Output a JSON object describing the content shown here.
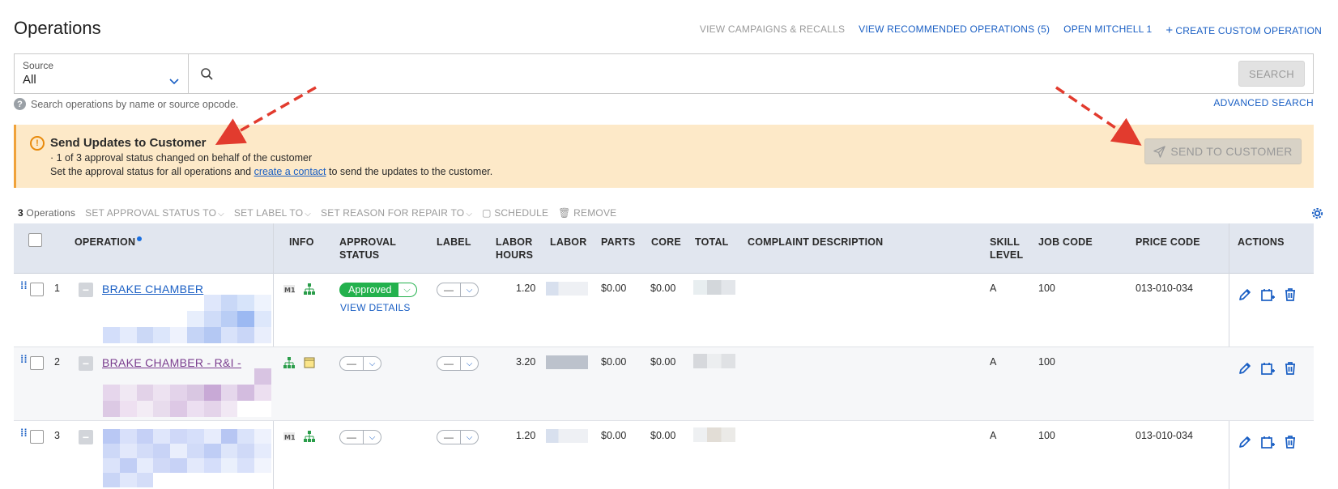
{
  "header": {
    "title": "Operations",
    "links": {
      "campaigns": "VIEW CAMPAIGNS & RECALLS",
      "recommended": "VIEW RECOMMENDED OPERATIONS (5)",
      "mitchell": "OPEN MITCHELL 1",
      "create": "CREATE CUSTOM OPERATION"
    }
  },
  "search": {
    "source_label": "Source",
    "source_value": "All",
    "placeholder": "",
    "button": "SEARCH",
    "hint": "Search operations by name or source opcode.",
    "advanced": "ADVANCED SEARCH"
  },
  "alert": {
    "title": "Send Updates to Customer",
    "line1": "· 1 of 3 approval status changed on behalf of the customer",
    "line2_pre": "Set the approval status for all operations and",
    "line2_link": "create a contact",
    "line2_post": "to send the updates to the customer.",
    "button": "SEND TO CUSTOMER",
    "colors": {
      "background": "#fde9c8",
      "accent": "#f0a23a"
    }
  },
  "toolbar": {
    "count": "3",
    "count_label": "Operations",
    "approval": "SET APPROVAL STATUS TO",
    "label": "SET LABEL TO",
    "reason": "SET REASON FOR REPAIR TO",
    "schedule": "SCHEDULE",
    "remove": "REMOVE"
  },
  "columns": {
    "operation": "OPERATION",
    "info": "INFO",
    "approval_1": "APPROVAL",
    "approval_2": "STATUS",
    "label": "LABEL",
    "labor_hours_1": "LABOR",
    "labor_hours_2": "HOURS",
    "labor": "LABOR",
    "parts": "PARTS",
    "core": "CORE",
    "total": "TOTAL",
    "complaint": "COMPLAINT DESCRIPTION",
    "skill_1": "SKILL",
    "skill_2": "LEVEL",
    "job_code": "JOB CODE",
    "price_code": "PRICE CODE",
    "actions": "ACTIONS"
  },
  "rows": [
    {
      "num": "1",
      "operation": "BRAKE CHAMBER",
      "approval": "Approved",
      "view_details": "VIEW DETAILS",
      "label": "—",
      "labor_hours": "1.20",
      "parts": "$0.00",
      "core": "$0.00",
      "skill": "A",
      "job_code": "100",
      "price_code": "013-010-034"
    },
    {
      "num": "2",
      "operation": "BRAKE CHAMBER - R&I -",
      "approval": "—",
      "label": "—",
      "labor_hours": "3.20",
      "parts": "$0.00",
      "core": "$0.00",
      "skill": "A",
      "job_code": "100",
      "price_code": ""
    },
    {
      "num": "3",
      "operation": "",
      "approval": "—",
      "label": "—",
      "labor_hours": "1.20",
      "parts": "$0.00",
      "core": "$0.00",
      "skill": "A",
      "job_code": "100",
      "price_code": "013-010-034"
    }
  ],
  "colors": {
    "link": "#1a5fc4",
    "approved": "#23b14d",
    "visited": "#7a3c8e"
  }
}
